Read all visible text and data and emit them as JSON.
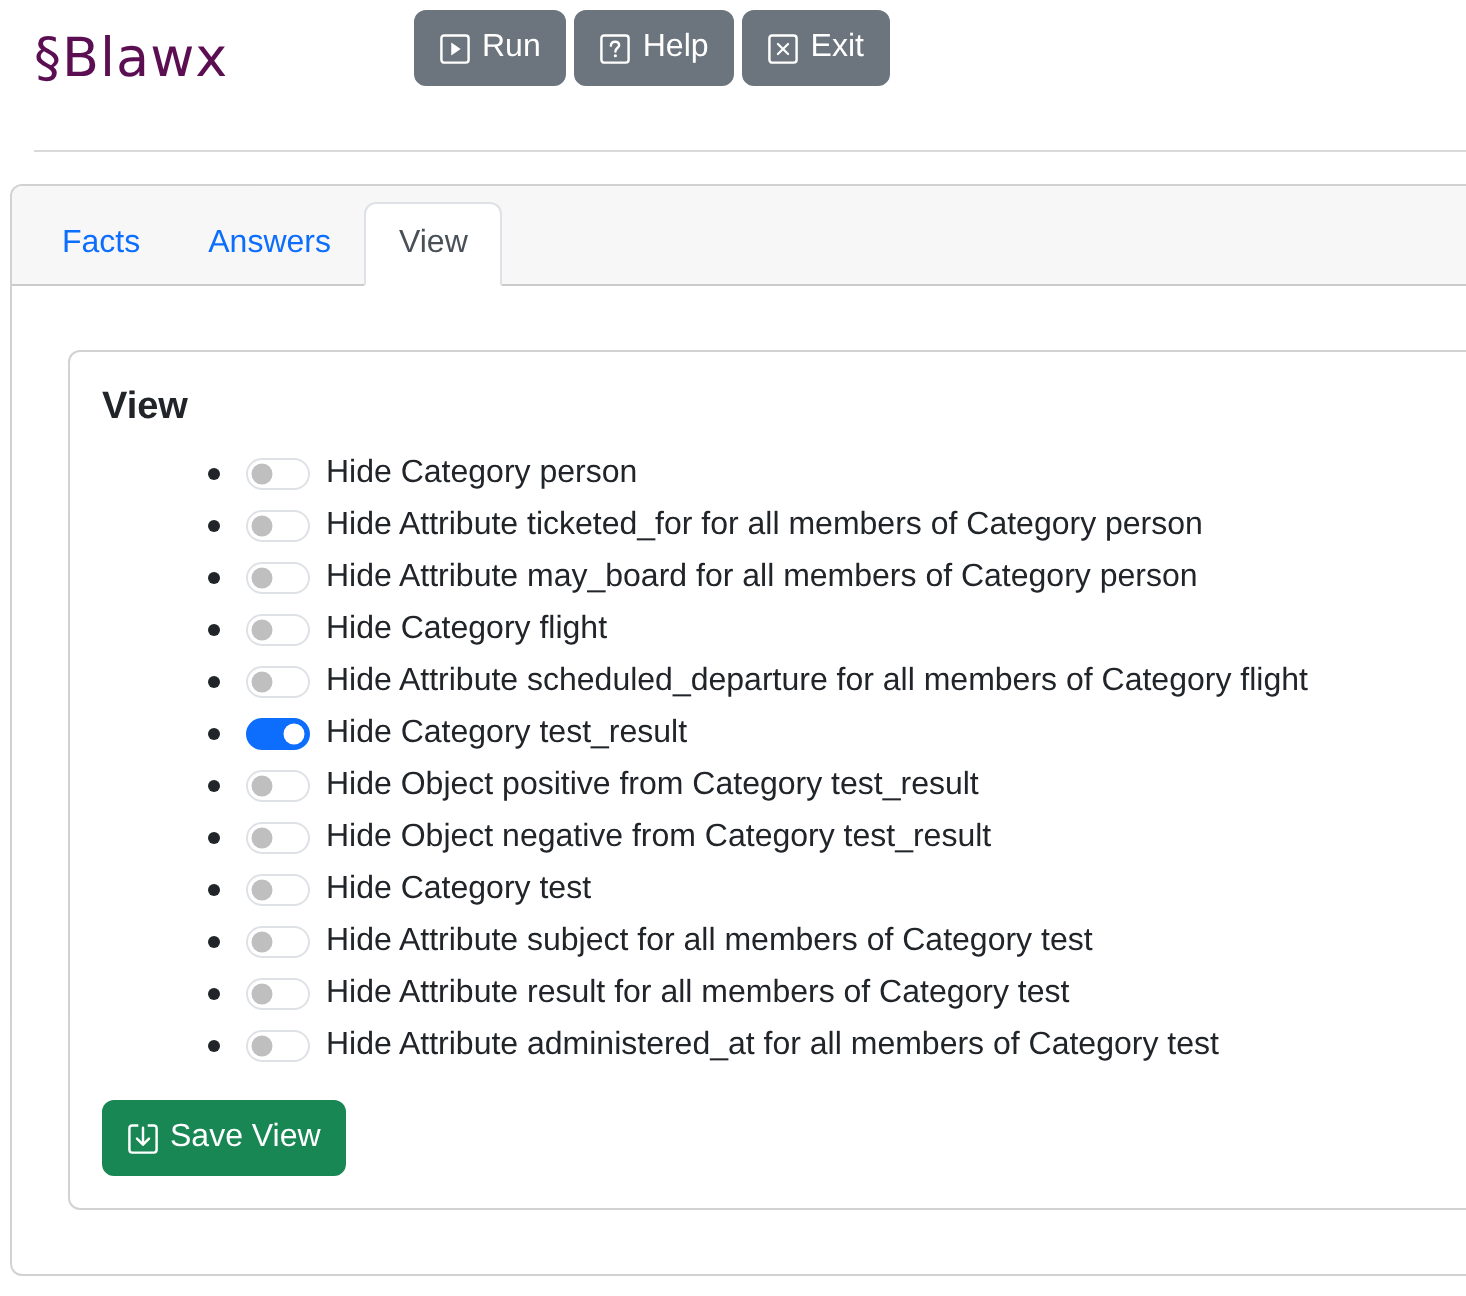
{
  "header": {
    "logo": "§Blawx",
    "buttons": [
      {
        "label": "Run",
        "kind": "run"
      },
      {
        "label": "Help",
        "kind": "help"
      },
      {
        "label": "Exit",
        "kind": "exit"
      }
    ]
  },
  "tabs": [
    {
      "label": "Facts",
      "selected": false
    },
    {
      "label": "Answers",
      "selected": false
    },
    {
      "label": "View",
      "selected": true
    }
  ],
  "view": {
    "title": "View",
    "options": [
      {
        "label": "Hide Category person",
        "on": false
      },
      {
        "label": "Hide Attribute ticketed_for for all members of Category person",
        "on": false
      },
      {
        "label": "Hide Attribute may_board for all members of Category person",
        "on": false
      },
      {
        "label": "Hide Category flight",
        "on": false
      },
      {
        "label": "Hide Attribute scheduled_departure for all members of Category flight",
        "on": false
      },
      {
        "label": "Hide Category test_result",
        "on": true
      },
      {
        "label": "Hide Object positive from Category test_result",
        "on": false
      },
      {
        "label": "Hide Object negative from Category test_result",
        "on": false
      },
      {
        "label": "Hide Category test",
        "on": false
      },
      {
        "label": "Hide Attribute subject for all members of Category test",
        "on": false
      },
      {
        "label": "Hide Attribute result for all members of Category test",
        "on": false
      },
      {
        "label": "Hide Attribute administered_at for all members of Category test",
        "on": false
      }
    ],
    "save_button": "Save View"
  }
}
